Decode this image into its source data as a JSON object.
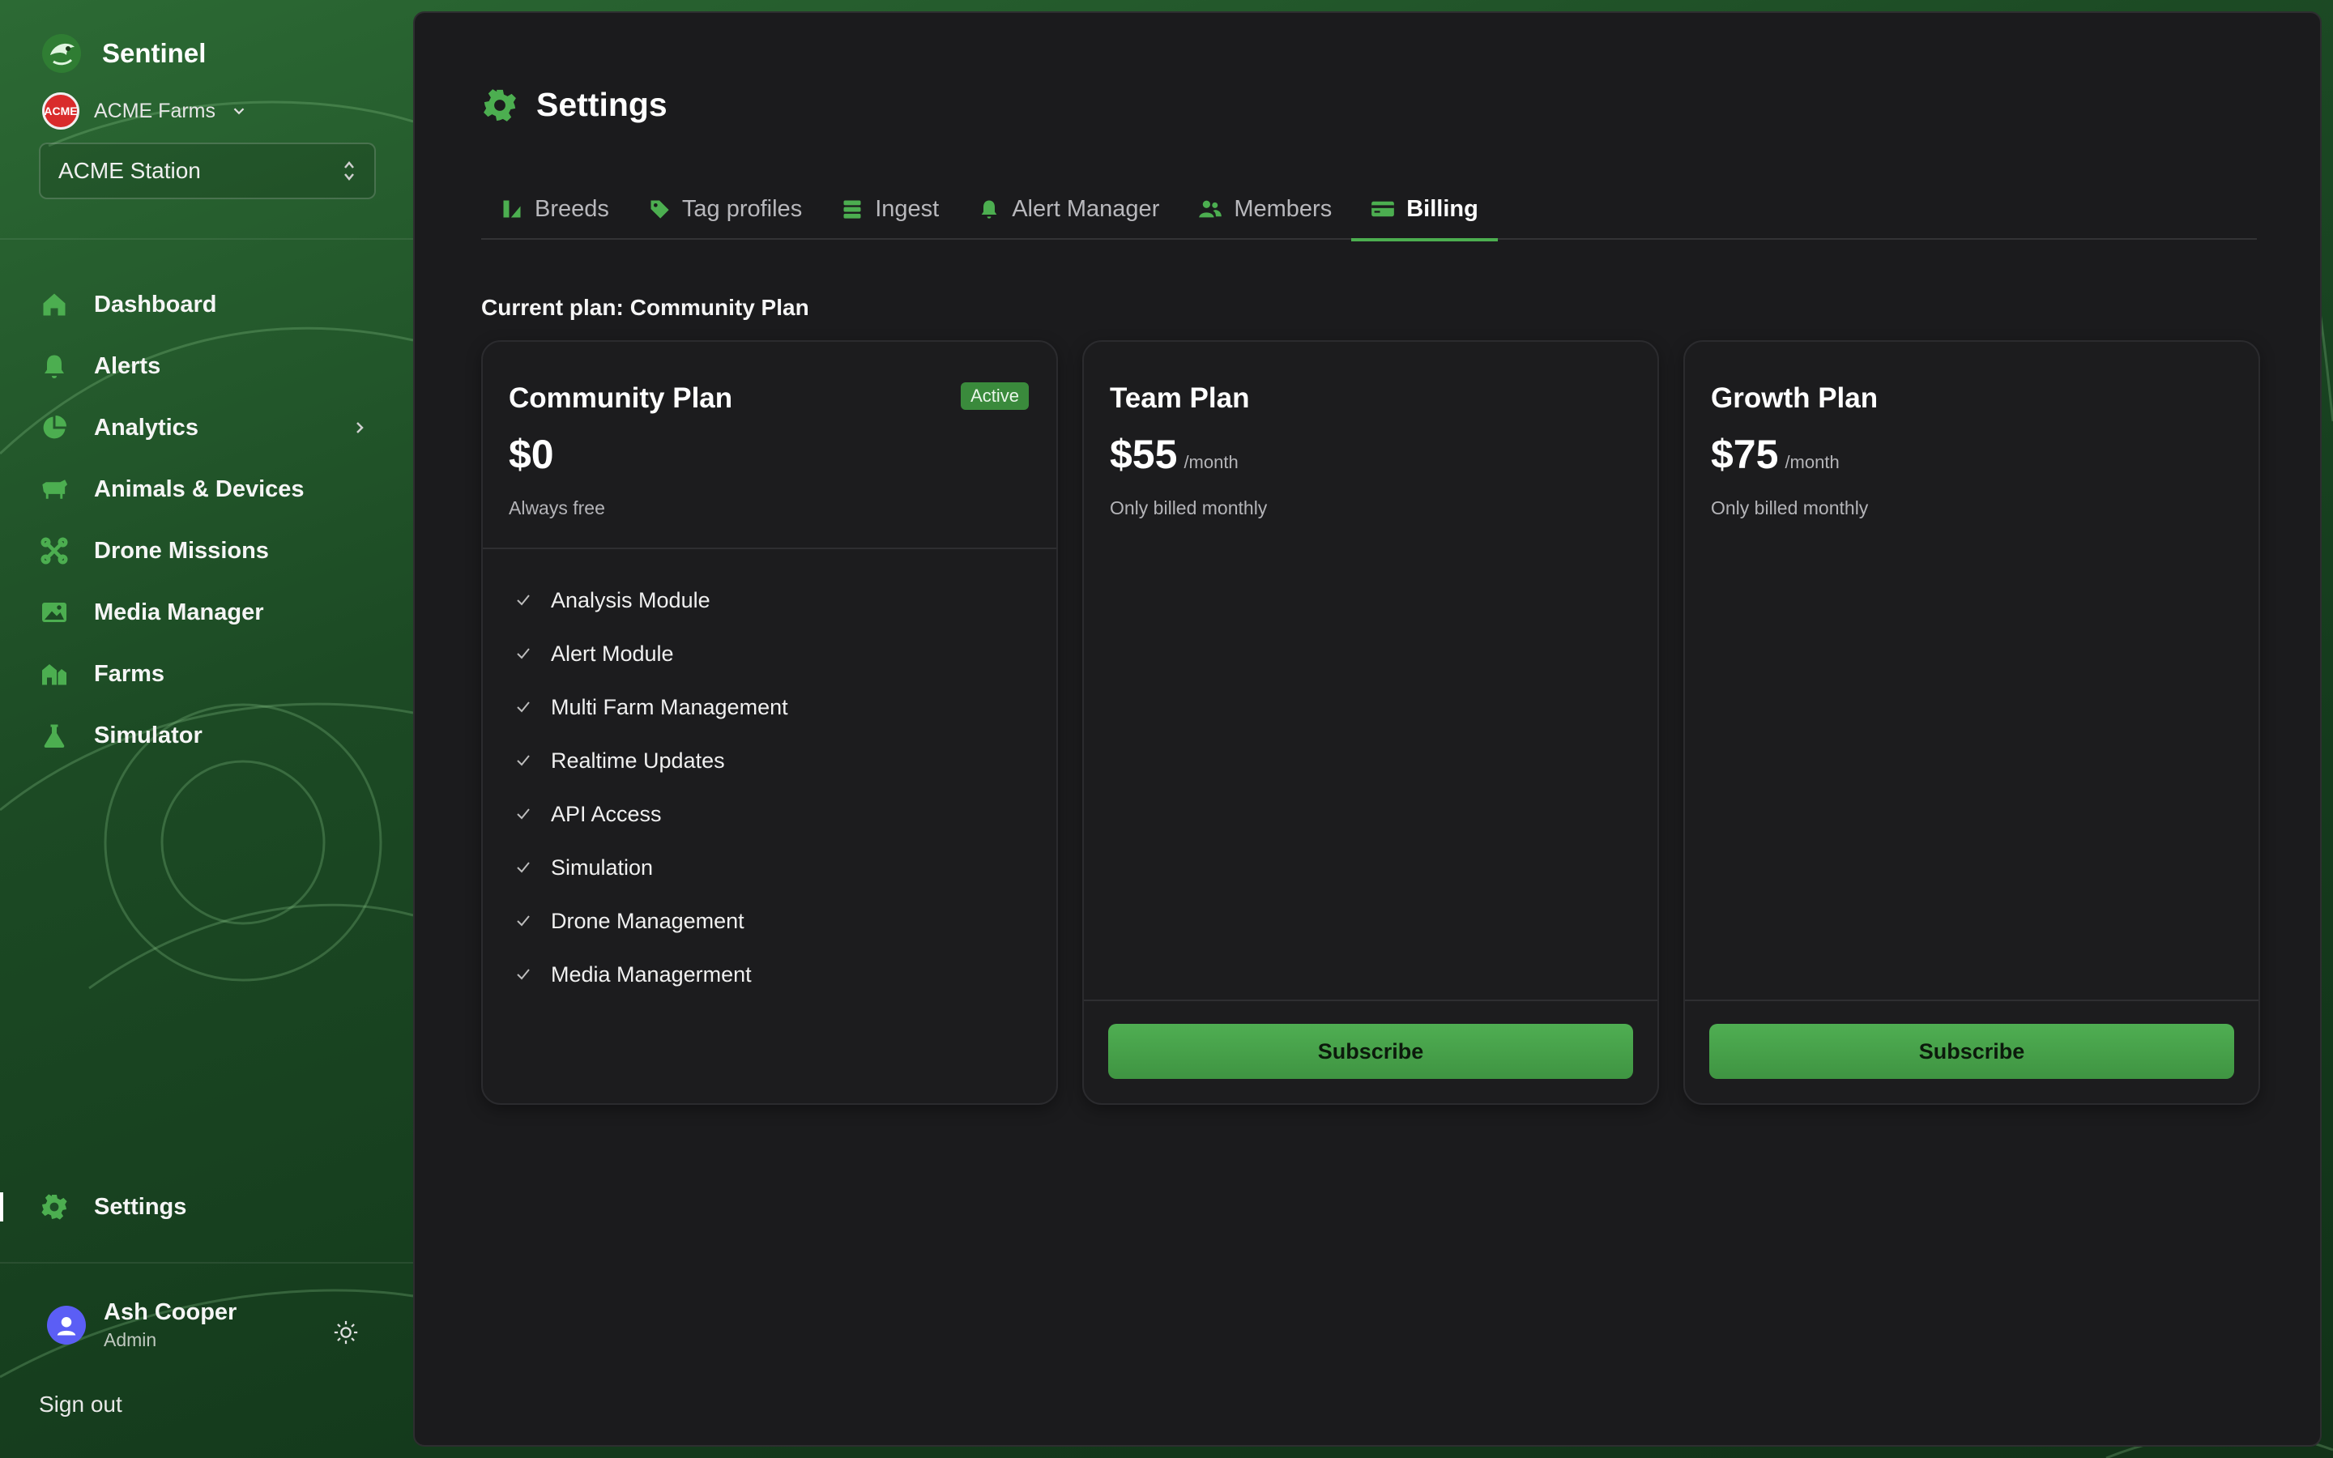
{
  "sidebar": {
    "brand": "Sentinel",
    "org": {
      "name": "ACME Farms",
      "logo_text": "ACME"
    },
    "station": "ACME Station",
    "nav": [
      {
        "label": "Dashboard",
        "icon": "home-icon"
      },
      {
        "label": "Alerts",
        "icon": "bell-icon"
      },
      {
        "label": "Analytics",
        "icon": "pie-chart-icon"
      },
      {
        "label": "Animals & Devices",
        "icon": "cow-icon"
      },
      {
        "label": "Drone Missions",
        "icon": "drone-icon"
      },
      {
        "label": "Media Manager",
        "icon": "image-icon"
      },
      {
        "label": "Farms",
        "icon": "barn-icon"
      },
      {
        "label": "Simulator",
        "icon": "flask-icon"
      }
    ],
    "settings_label": "Settings",
    "user": {
      "name": "Ash Cooper",
      "role": "Admin"
    },
    "signout": "Sign out"
  },
  "page": {
    "title": "Settings",
    "tabs": [
      {
        "label": "Breeds",
        "icon": "breeds-icon"
      },
      {
        "label": "Tag profiles",
        "icon": "tag-icon"
      },
      {
        "label": "Ingest",
        "icon": "database-icon"
      },
      {
        "label": "Alert Manager",
        "icon": "bell-icon"
      },
      {
        "label": "Members",
        "icon": "users-icon"
      },
      {
        "label": "Billing",
        "icon": "credit-card-icon",
        "active": true
      }
    ],
    "current_plan_label": "Current plan:",
    "current_plan_name": "Community Plan"
  },
  "plans": [
    {
      "name": "Community Plan",
      "badge": "Active",
      "price": "$0",
      "period": "",
      "note": "Always free",
      "features": [
        "Analysis Module",
        "Alert Module",
        "Multi Farm Management",
        "Realtime Updates",
        "API Access",
        "Simulation",
        "Drone Management",
        "Media Managerment"
      ]
    },
    {
      "name": "Team Plan",
      "price": "$55",
      "period": "/month",
      "note": "Only billed monthly",
      "button": "Subscribe"
    },
    {
      "name": "Growth Plan",
      "price": "$75",
      "period": "/month",
      "note": "Only billed monthly",
      "button": "Subscribe"
    }
  ],
  "colors": {
    "accent": "#4cae50",
    "panel": "#1b1b1d",
    "sidebar_green": "#1c4a24"
  }
}
